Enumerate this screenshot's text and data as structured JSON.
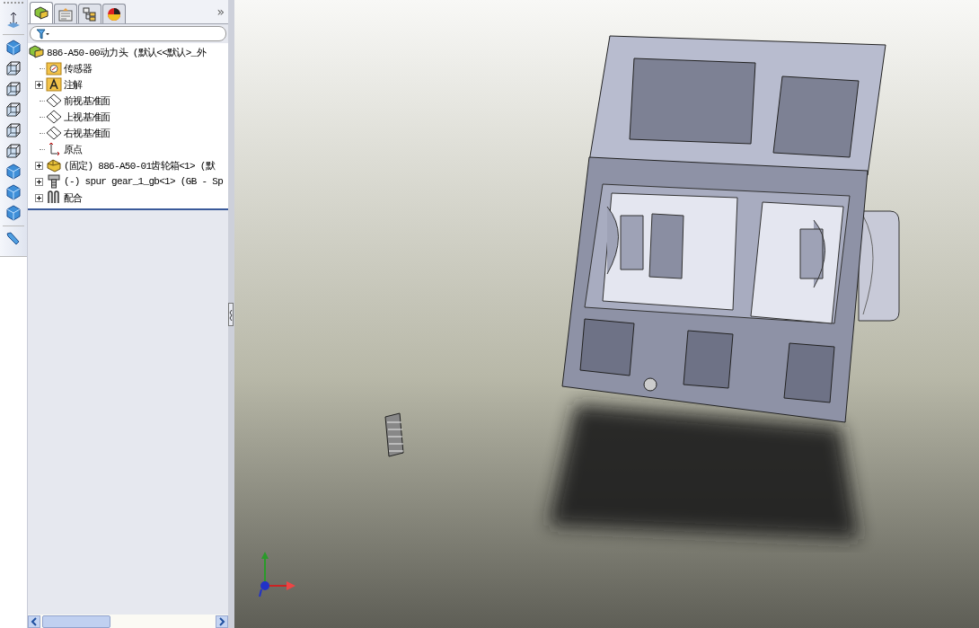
{
  "toolbar": {
    "kind": "view-strip"
  },
  "panel_tabs": [
    {
      "selected": true
    },
    {
      "selected": false
    },
    {
      "selected": false
    },
    {
      "selected": false
    }
  ],
  "panel_more": "»",
  "tree": {
    "label": "886-A50-00动力头  (默认<<默认>_外",
    "children": [
      {
        "label": "传感器",
        "kind": "sensor",
        "expander": false
      },
      {
        "label": "注解",
        "kind": "annotation",
        "expander": true
      },
      {
        "label": "前视基准面",
        "kind": "plane",
        "expander": false
      },
      {
        "label": "上视基准面",
        "kind": "plane",
        "expander": false
      },
      {
        "label": "右视基准面",
        "kind": "plane",
        "expander": false
      },
      {
        "label": "原点",
        "kind": "origin",
        "expander": false
      },
      {
        "label": "(固定) 886-A50-01齿轮箱<1> (默",
        "kind": "part",
        "expander": true
      },
      {
        "label": "(-) spur gear_1_gb<1> (GB - Sp",
        "kind": "bolt",
        "expander": true
      },
      {
        "label": "配合",
        "kind": "mate",
        "expander": true
      }
    ]
  }
}
